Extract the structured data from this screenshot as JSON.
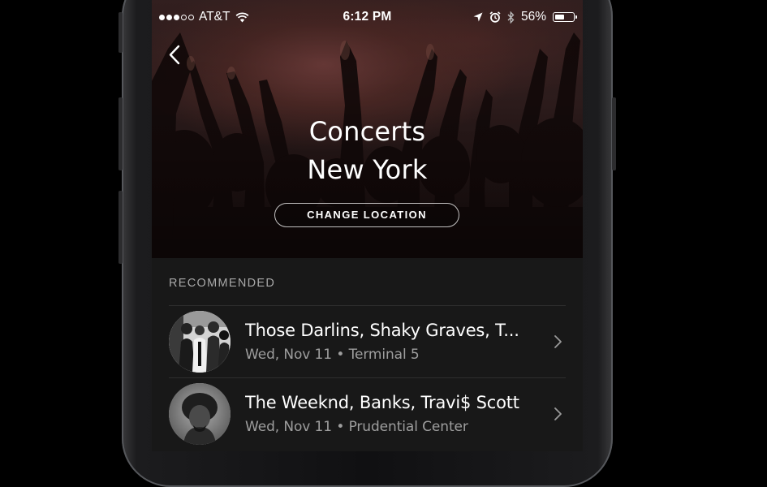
{
  "status_bar": {
    "carrier": "AT&T",
    "time": "6:12 PM",
    "battery": "56%",
    "battery_level": 0.56,
    "signal_bars": 3,
    "signal_total": 5
  },
  "header": {
    "title_line1": "Concerts",
    "title_line2": "New York",
    "change_location_label": "CHANGE LOCATION"
  },
  "section": {
    "label": "RECOMMENDED"
  },
  "concerts": [
    {
      "title": "Those Darlins, Shaky Graves, T...",
      "date": "Wed, Nov 11",
      "venue": "Terminal 5"
    },
    {
      "title": "The Weeknd, Banks, Travi$ Scott",
      "date": "Wed, Nov 11",
      "venue": "Prudential Center"
    }
  ],
  "separator": "•",
  "colors": {
    "background": "#181818",
    "secondary_text": "#9e9e9e",
    "section_label": "#a8a8a8"
  },
  "icons": [
    "wifi-icon",
    "location-arrow-icon",
    "alarm-icon",
    "bluetooth-icon",
    "battery-icon",
    "back-chevron-icon",
    "chevron-right-icon"
  ]
}
